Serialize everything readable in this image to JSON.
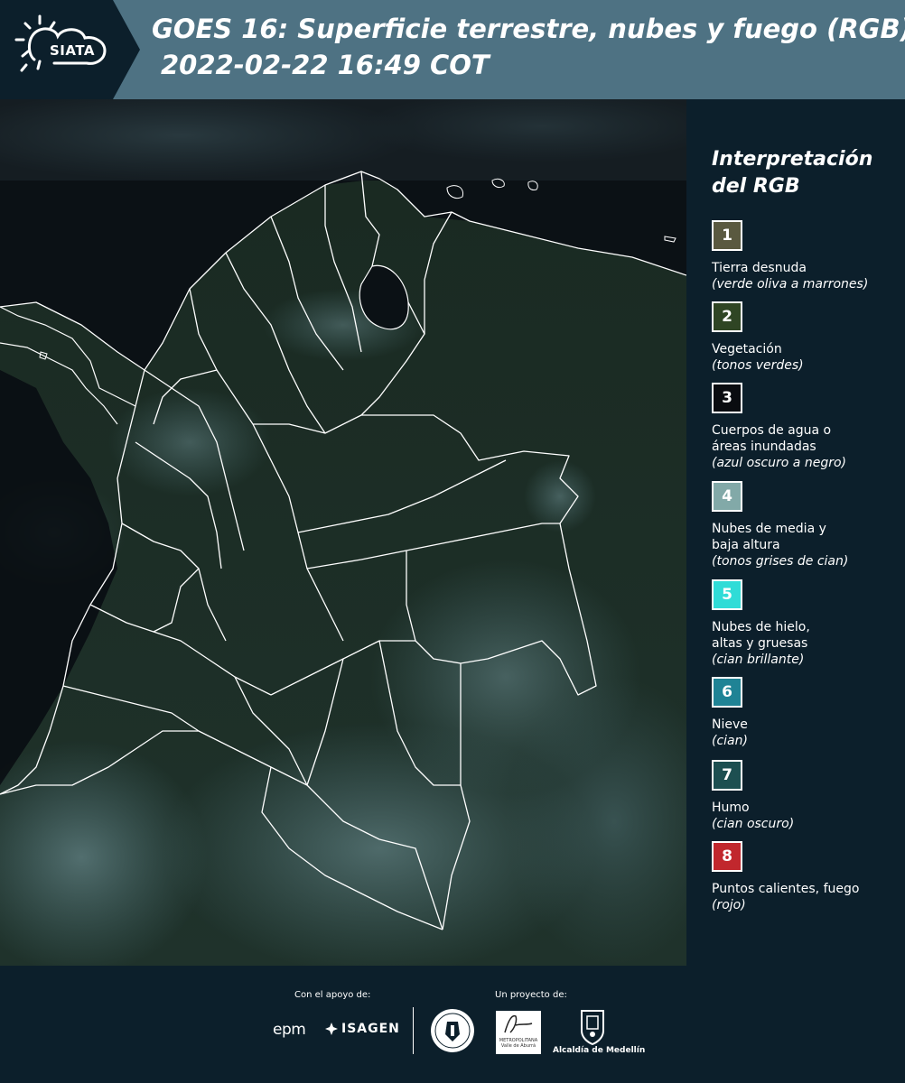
{
  "header": {
    "logo_text": "SIATA",
    "title": "GOES 16: Superficie terrestre, nubes y fuego (RGB)",
    "timestamp": "2022-02-22 16:49 COT",
    "background_color": "#4e7283",
    "logo_panel_color": "#0c1f2b"
  },
  "legend": {
    "title": "Interpretación del RGB",
    "items": [
      {
        "number": "1",
        "label": "Tierra desnuda",
        "description": "(verde oliva a marrones)",
        "color": "#5a5940"
      },
      {
        "number": "2",
        "label": "Vegetación",
        "description": "(tonos verdes)",
        "color": "#2f4524"
      },
      {
        "number": "3",
        "label": "Cuerpos de agua o áreas inundadas",
        "description": "(azul oscuro a negro)",
        "color": "#0a0c10"
      },
      {
        "number": "4",
        "label": "Nubes de media y baja altura",
        "description": "(tonos grises de cian)",
        "color": "#82a9a8"
      },
      {
        "number": "5",
        "label": "Nubes de hielo, altas y gruesas",
        "description": "(cian brillante)",
        "color": "#30dcd7"
      },
      {
        "number": "6",
        "label": "Nieve",
        "description": "(cian)",
        "color": "#1f8395"
      },
      {
        "number": "7",
        "label": "Humo",
        "description": "(cian oscuro)",
        "color": "#1d4f51"
      },
      {
        "number": "8",
        "label": "Puntos calientes, fuego",
        "description": "(rojo)",
        "color": "#c1272d"
      }
    ]
  },
  "map": {
    "land_color": "#1e2e24",
    "ocean_color": "#0d1216",
    "cloud_color": "#5f8a92",
    "border_color": "#ffffff"
  },
  "footer": {
    "support_label": "Con el apoyo de:",
    "project_label": "Un proyecto de:",
    "epm_text": "epm",
    "isagen_text": "ISAGEN",
    "area_text": "METROPOLITANA Valle de Aburrá",
    "alcaldia_text": "Alcaldía de Medellín"
  }
}
